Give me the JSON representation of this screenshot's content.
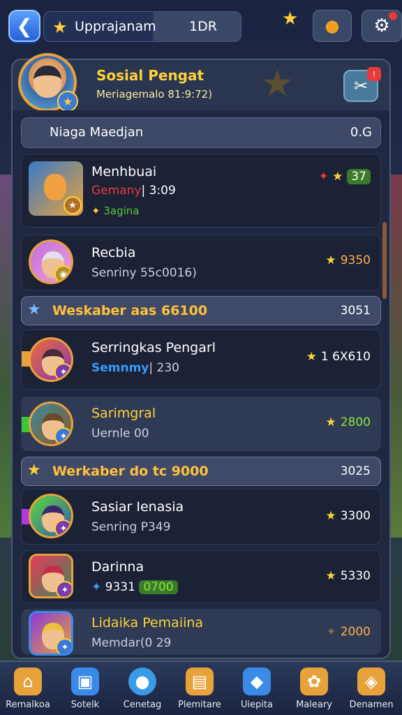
{
  "topbar": {
    "back_glyph": "❮",
    "title_star": "★",
    "title": "Upprajanam",
    "code": "1DR",
    "star_icon": "★",
    "coin_icon": "●",
    "gear_icon": "⚙"
  },
  "header": {
    "title": "Sosial Pengat",
    "subtitle": "Meriagemalo 81:9:72)",
    "tool_icon": "✂",
    "badge_star": "★"
  },
  "summary_row": {
    "label": "Niaga Maedjan",
    "value": "0.G"
  },
  "cards": [
    {
      "name": "Menhbuai",
      "tag": "Gemany",
      "tag_extra": "| 3:09",
      "chip": "3agina",
      "score": "37",
      "score_prefix": "✦",
      "colors": {
        "tag": "#e83a3a",
        "chip": "#5ac83a"
      }
    },
    {
      "name": "Recbia",
      "sub": "Senriny 55c0016)",
      "score": "9350"
    },
    {
      "name": "Serringkas Pengarl",
      "tag": "Semnmy",
      "tag_extra": "| 230",
      "score": "1 6X610",
      "colors": {
        "tag": "#3a9aff"
      }
    },
    {
      "name": "Sarimgral",
      "sub": "Uernle 00",
      "score": "2800"
    },
    {
      "name": "Sasiar Ienasia",
      "sub": "Senring P349",
      "score": "3300"
    },
    {
      "name": "Darinna",
      "sub": "9331",
      "chip": "0700",
      "score": "5330"
    },
    {
      "name": "Lidaika Pemaiina",
      "sub": "Memdar(0 29",
      "score": "2000"
    }
  ],
  "sections": [
    {
      "label": "Weskaber aas 66100",
      "value": "3051"
    },
    {
      "label": "Werkaber do tc 9000",
      "value": "3025"
    }
  ],
  "bottom_nav": [
    {
      "label": "Remalkoa",
      "icon": "house-icon",
      "glyph": "⌂",
      "color": "#e8a23a"
    },
    {
      "label": "Sotelk",
      "icon": "shop-icon",
      "glyph": "▣",
      "color": "#3a8ae8"
    },
    {
      "label": "Cenetag",
      "icon": "orb-icon",
      "glyph": "●",
      "color": "#3a9ae8"
    },
    {
      "label": "Plemitare",
      "icon": "scroll-icon",
      "glyph": "▤",
      "color": "#e8a23a"
    },
    {
      "label": "Uiepita",
      "icon": "gift-icon",
      "glyph": "◆",
      "color": "#3a8ae8"
    },
    {
      "label": "Maleary",
      "icon": "pet-icon",
      "glyph": "✿",
      "color": "#e8a23a"
    },
    {
      "label": "Denamen",
      "icon": "map-icon",
      "glyph": "◈",
      "color": "#e8a23a"
    }
  ]
}
